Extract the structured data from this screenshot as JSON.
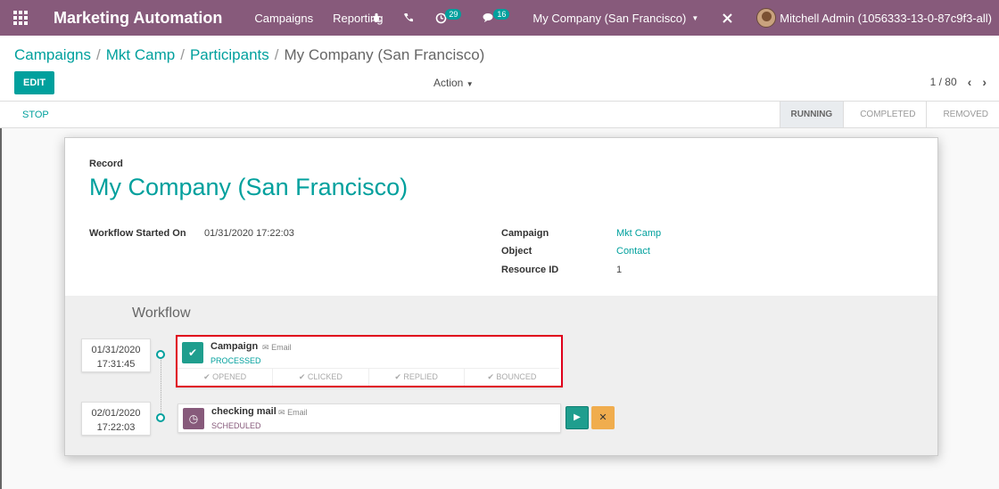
{
  "nav": {
    "brand": "Marketing Automation",
    "menus": [
      "Campaigns",
      "Reporting"
    ],
    "activity_badge": "29",
    "message_badge": "16",
    "company": "My Company (San Francisco)",
    "user": "Mitchell Admin (1056333-13-0-87c9f3-all)",
    "colors": {
      "nav_bg": "#875a7b",
      "accent": "#00a09d"
    }
  },
  "breadcrumb": {
    "items": [
      "Campaigns",
      "Mkt Camp",
      "Participants"
    ],
    "current": "My Company (San Francisco)"
  },
  "toolbar": {
    "edit_label": "EDIT",
    "action_label": "Action",
    "pager": "1 / 80"
  },
  "statusbar": {
    "stop_label": "STOP",
    "stages": [
      "RUNNING",
      "COMPLETED",
      "REMOVED"
    ],
    "active_stage": "RUNNING"
  },
  "record": {
    "label": "Record",
    "title": "My Company (San Francisco)",
    "workflow_started_label": "Workflow Started On",
    "workflow_started_value": "01/31/2020 17:22:03",
    "campaign_label": "Campaign",
    "campaign_value": "Mkt Camp",
    "object_label": "Object",
    "object_value": "Contact",
    "resource_label": "Resource ID",
    "resource_value": "1"
  },
  "workflow": {
    "title": "Workflow",
    "activities": [
      {
        "date": "01/31/2020",
        "time": "17:31:45",
        "name": "Campaign",
        "type": "Email",
        "status": "PROCESSED",
        "stats": [
          "OPENED",
          "CLICKED",
          "REPLIED",
          "BOUNCED"
        ]
      },
      {
        "date": "02/01/2020",
        "time": "17:22:03",
        "name": "checking mail",
        "type": "Email",
        "status": "SCHEDULED"
      }
    ]
  }
}
